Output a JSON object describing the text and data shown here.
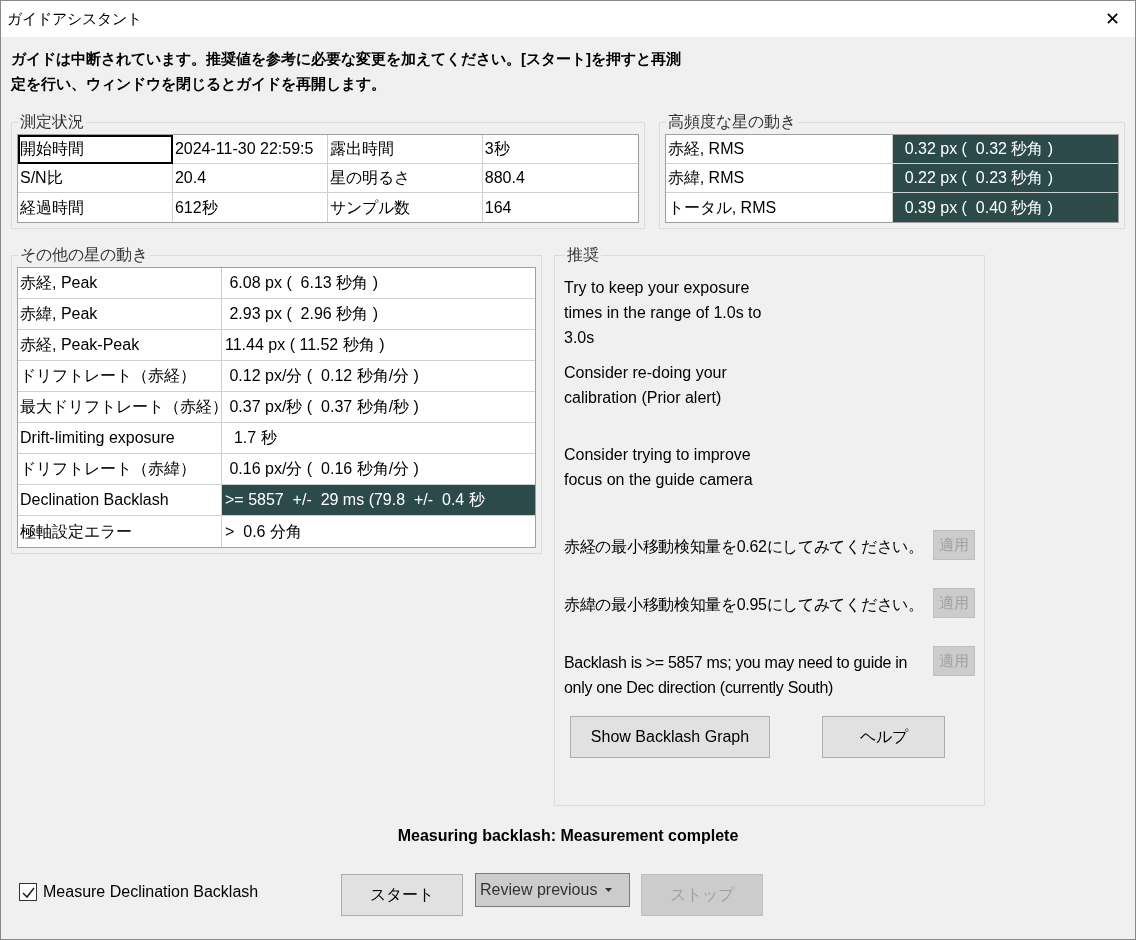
{
  "window": {
    "title": "ガイドアシスタント",
    "close": "✕"
  },
  "message": "ガイドは中断されています。推奨値を参考に必要な変更を加えてください。[スタート]を押すと再測定を行い、ウィンドウを閉じるとガイドを再開します。",
  "measurement": {
    "title": "測定状況",
    "rows": [
      [
        {
          "text": "開始時間",
          "selected": true
        },
        {
          "text": "2024-11-30 22:59:5",
          "selected": false
        },
        {
          "text": "露出時間",
          "selected": false
        },
        {
          "text": "3秒",
          "selected": false
        }
      ],
      [
        {
          "text": "S/N比",
          "selected": false
        },
        {
          "text": "20.4",
          "selected": false
        },
        {
          "text": "星の明るさ",
          "selected": false
        },
        {
          "text": "880.4",
          "selected": false
        }
      ],
      [
        {
          "text": "経過時間",
          "selected": false
        },
        {
          "text": "612秒",
          "selected": false
        },
        {
          "text": "サンプル数",
          "selected": false
        },
        {
          "text": "164",
          "selected": false
        }
      ]
    ]
  },
  "high_frequency": {
    "title": "高頻度な星の動き",
    "rows": [
      {
        "label": "赤経, RMS",
        "value": "0.32 px (  0.32 秒角 )",
        "highlighted": true
      },
      {
        "label": "赤緯, RMS",
        "value": "0.22 px (  0.23 秒角 )",
        "highlighted": true
      },
      {
        "label": "トータル, RMS",
        "value": "0.39 px (  0.40 秒角 )",
        "highlighted": true
      }
    ]
  },
  "other_motion": {
    "title": "その他の星の動き",
    "rows": [
      {
        "label": "赤経, Peak",
        "value": " 6.08 px (  6.13 秒角 )",
        "highlighted": false
      },
      {
        "label": "赤緯, Peak",
        "value": " 2.93 px (  2.96 秒角 )",
        "highlighted": false
      },
      {
        "label": "赤経, Peak-Peak",
        "value": "11.44 px ( 11.52 秒角 )",
        "highlighted": false
      },
      {
        "label": "ドリフトレート（赤経）",
        "value": " 0.12 px/分 (  0.12 秒角/分 )",
        "highlighted": false
      },
      {
        "label": "最大ドリフトレート（赤経）",
        "value": " 0.37 px/秒 (  0.37 秒角/秒 )",
        "highlighted": false
      },
      {
        "label": "Drift-limiting exposure",
        "value": "  1.7 秒",
        "highlighted": false
      },
      {
        "label": "ドリフトレート（赤緯）",
        "value": " 0.16 px/分 (  0.16 秒角/分 )",
        "highlighted": false
      },
      {
        "label": "Declination Backlash",
        "value": ">= 5857  +/-  29 ms (79.8  +/-  0.4 秒",
        "highlighted": true
      },
      {
        "label": "極軸設定エラー",
        "value": ">  0.6 分角",
        "highlighted": false
      }
    ]
  },
  "recommendations": {
    "title": "推奨",
    "items": [
      {
        "text": "Try to keep your exposure times in the range of 1.0s to 3.0s"
      },
      {
        "text": "Consider re-doing your calibration (Prior alert)"
      },
      {
        "text": "Consider trying to improve focus on the guide camera"
      },
      {
        "text": "赤経の最小移動検知量を0.62にしてみてください。",
        "apply": {
          "label": "適用",
          "disabled": true
        }
      },
      {
        "text": "赤緯の最小移動検知量を0.95にしてみてください。",
        "apply": {
          "label": "適用",
          "disabled": true
        }
      },
      {
        "text": "Backlash is >= 5857 ms; you may need to guide in only one Dec direction (currently South)",
        "apply": {
          "label": "適用",
          "disabled": true
        }
      }
    ],
    "buttons": [
      {
        "label": "Show Backlash Graph",
        "disabled": false
      },
      {
        "label": "ヘルプ",
        "disabled": false
      }
    ]
  },
  "status": "Measuring backlash: Measurement complete",
  "measure_backlash": {
    "label": "Measure Declination Backlash",
    "checked": true
  },
  "start": {
    "label": "スタート",
    "disabled": false
  },
  "review": {
    "label": "Review previous"
  },
  "stop": {
    "label": "ストップ",
    "disabled": true
  }
}
